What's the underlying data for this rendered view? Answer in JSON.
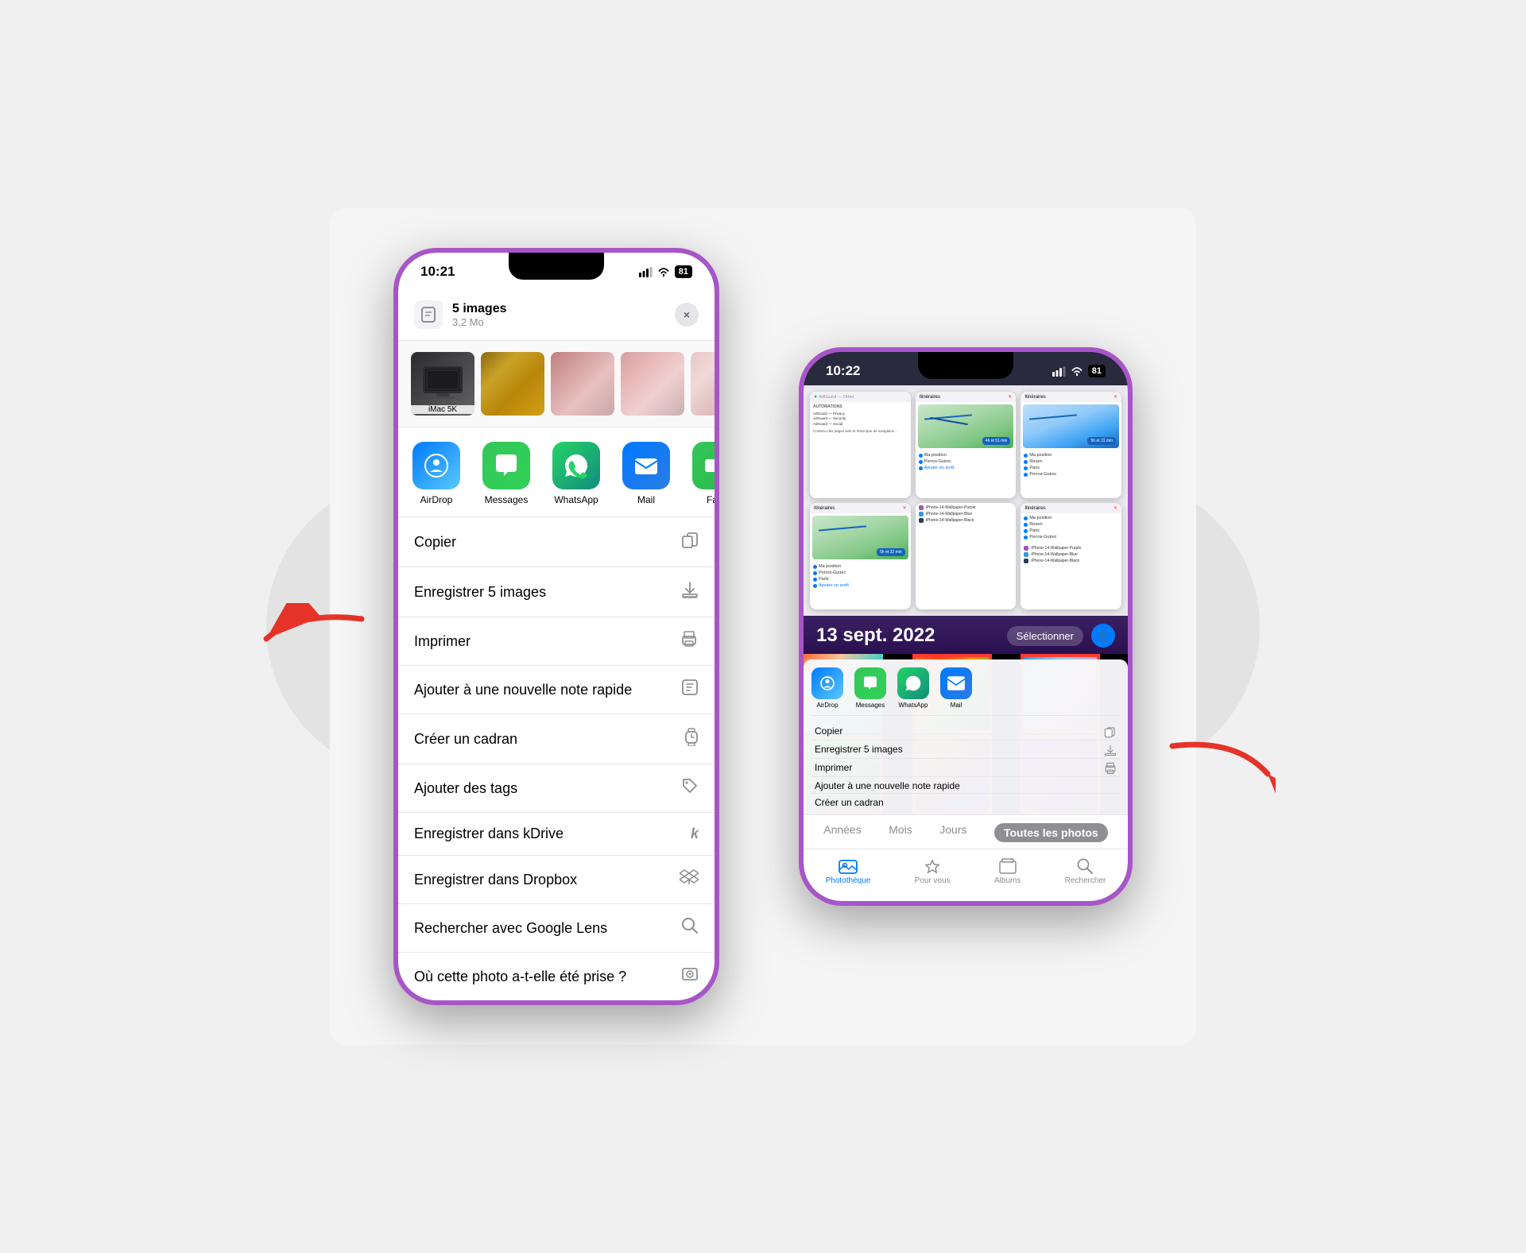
{
  "scene": {
    "background": "#f0f0f0"
  },
  "phone1": {
    "status": {
      "time": "10:21",
      "battery": "81",
      "signal": true,
      "wifi": true
    },
    "shareSheet": {
      "title": "5 images",
      "subtitle": "3,2 Mo",
      "closeLabel": "×",
      "thumbnails": [
        {
          "label": "iMac 5K",
          "type": "imac"
        },
        {
          "label": "",
          "type": "pixel1"
        },
        {
          "label": "",
          "type": "pixel2"
        },
        {
          "label": "",
          "type": "pixel3"
        },
        {
          "label": "",
          "type": "pixel4"
        }
      ],
      "apps": [
        {
          "label": "AirDrop",
          "type": "airdrop"
        },
        {
          "label": "Messages",
          "type": "messages"
        },
        {
          "label": "WhatsApp",
          "type": "whatsapp"
        },
        {
          "label": "Mail",
          "type": "mail"
        },
        {
          "label": "Fa...",
          "type": "facetime"
        }
      ],
      "actions": [
        {
          "label": "Copier",
          "icon": "📋"
        },
        {
          "label": "Enregistrer 5 images",
          "icon": "⬇"
        },
        {
          "label": "Imprimer",
          "icon": "🖨"
        },
        {
          "label": "Ajouter à une nouvelle note rapide",
          "icon": "📝"
        },
        {
          "label": "Créer un cadran",
          "icon": "⌚"
        },
        {
          "label": "Ajouter des tags",
          "icon": "🏷"
        },
        {
          "label": "Enregistrer dans kDrive",
          "icon": "k"
        },
        {
          "label": "Enregistrer dans Dropbox",
          "icon": "◈"
        },
        {
          "label": "Rechercher avec Google Lens",
          "icon": "🔍"
        },
        {
          "label": "Où cette photo a-t-elle été prise ?",
          "icon": "🖼"
        }
      ]
    }
  },
  "phone2": {
    "status": {
      "time": "10:22",
      "battery": "81",
      "signal": true,
      "wifi": true
    },
    "photosApp": {
      "date": "13 sept. 2022",
      "selectLabel": "Sélectionner",
      "tabs": [
        {
          "label": "Années",
          "active": false
        },
        {
          "label": "Mois",
          "active": false
        },
        {
          "label": "Jours",
          "active": false
        },
        {
          "label": "Toutes les photos",
          "active": true
        }
      ],
      "bottomTabs": [
        {
          "label": "Photothèque",
          "active": true,
          "icon": "🖼"
        },
        {
          "label": "Pour vous",
          "active": false,
          "icon": "❤"
        },
        {
          "label": "Albums",
          "active": false,
          "icon": "📁"
        },
        {
          "label": "Rechercher",
          "active": false,
          "icon": "🔍"
        }
      ]
    },
    "miniShareSheet": {
      "apps": [
        {
          "label": "AirDrop",
          "type": "airdrop"
        },
        {
          "label": "Messages",
          "type": "messages"
        },
        {
          "label": "WhatsApp",
          "type": "whatsapp"
        },
        {
          "label": "Mail",
          "type": "mail"
        }
      ],
      "actions": [
        {
          "label": "Copier"
        },
        {
          "label": "Enregistrer 5 images"
        },
        {
          "label": "Imprimer"
        },
        {
          "label": "Ajouter à une nouvelle note rapide"
        },
        {
          "label": "Créer un cadran"
        }
      ]
    }
  }
}
